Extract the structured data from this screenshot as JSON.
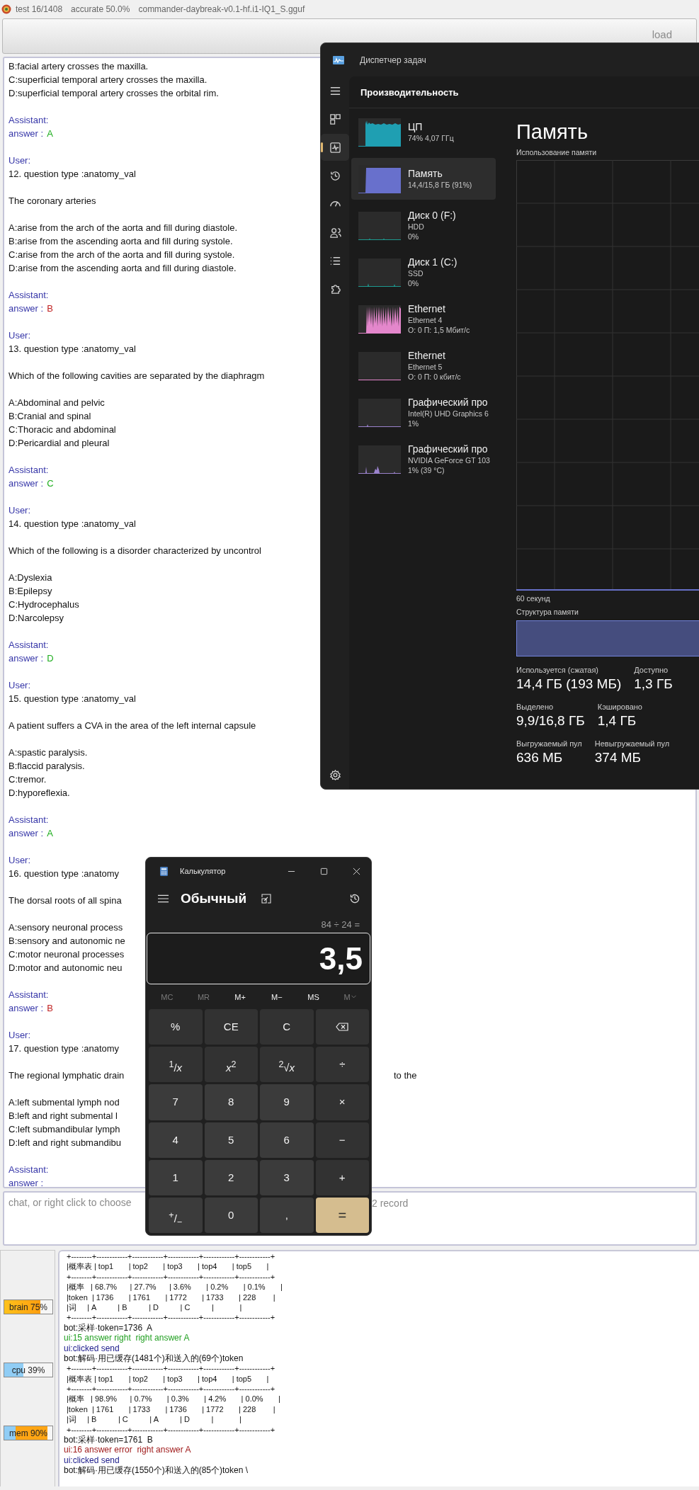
{
  "app": {
    "test": "test 16/1408",
    "accuracy": "accurate 50.0%",
    "model": "commander-daybreak-v0.1-hf.i1-IQ1_S.gguf",
    "load_button": "load"
  },
  "chat": {
    "lines": [
      {
        "kind": "option",
        "text": "B:facial artery crosses the maxilla."
      },
      {
        "kind": "option",
        "text": "C:superficial temporal artery crosses the maxilla."
      },
      {
        "kind": "option",
        "text": "D:superficial temporal artery crosses the orbital rim."
      },
      {
        "kind": "role",
        "text": "Assistant:"
      },
      {
        "kind": "answer",
        "text": "answer :",
        "choice": "A",
        "correct": true
      },
      {
        "kind": "role",
        "text": "User:"
      },
      {
        "kind": "header",
        "text": "12. question type :anatomy_val"
      },
      {
        "kind": "question",
        "text": "The coronary arteries"
      },
      {
        "kind": "option",
        "text": "A:arise from the arch of the aorta and fill during diastole."
      },
      {
        "kind": "option",
        "text": "B:arise from the ascending aorta and fill during systole."
      },
      {
        "kind": "option",
        "text": "C:arise from the arch of the aorta and fill during systole."
      },
      {
        "kind": "option",
        "text": "D:arise from the ascending aorta and fill during diastole."
      },
      {
        "kind": "role",
        "text": "Assistant:"
      },
      {
        "kind": "answer",
        "text": "answer :",
        "choice": "B",
        "correct": false
      },
      {
        "kind": "role",
        "text": "User:"
      },
      {
        "kind": "header",
        "text": "13. question type :anatomy_val"
      },
      {
        "kind": "question",
        "text": "Which of the following cavities are separated by the diaphragm"
      },
      {
        "kind": "option",
        "text": "A:Abdominal and pelvic"
      },
      {
        "kind": "option",
        "text": "B:Cranial and spinal"
      },
      {
        "kind": "option",
        "text": "C:Thoracic and abdominal"
      },
      {
        "kind": "option",
        "text": "D:Pericardial and pleural"
      },
      {
        "kind": "role",
        "text": "Assistant:"
      },
      {
        "kind": "answer",
        "text": "answer :",
        "choice": "C",
        "correct": true
      },
      {
        "kind": "role",
        "text": "User:"
      },
      {
        "kind": "header",
        "text": "14. question type :anatomy_val"
      },
      {
        "kind": "question",
        "text": "Which of the following is a disorder characterized by uncontrol"
      },
      {
        "kind": "option",
        "text": "A:Dyslexia"
      },
      {
        "kind": "option",
        "text": "B:Epilepsy"
      },
      {
        "kind": "option",
        "text": "C:Hydrocephalus"
      },
      {
        "kind": "option",
        "text": "D:Narcolepsy"
      },
      {
        "kind": "role",
        "text": "Assistant:"
      },
      {
        "kind": "answer",
        "text": "answer :",
        "choice": "D",
        "correct": true
      },
      {
        "kind": "role",
        "text": "User:"
      },
      {
        "kind": "header",
        "text": "15. question type :anatomy_val"
      },
      {
        "kind": "question",
        "text": "A patient suffers a CVA in the area of the left internal capsule"
      },
      {
        "kind": "option",
        "text": "A:spastic paralysis."
      },
      {
        "kind": "option",
        "text": "B:flaccid paralysis."
      },
      {
        "kind": "option",
        "text": "C:tremor."
      },
      {
        "kind": "option",
        "text": "D:hyporeflexia."
      },
      {
        "kind": "role",
        "text": "Assistant:"
      },
      {
        "kind": "answer",
        "text": "answer :",
        "choice": "A",
        "correct": true
      },
      {
        "kind": "role",
        "text": "User:"
      },
      {
        "kind": "header",
        "text": "16. question type :anatomy"
      },
      {
        "kind": "question",
        "text": "The dorsal roots of all spina"
      },
      {
        "kind": "option",
        "text": "A:sensory neuronal process"
      },
      {
        "kind": "option",
        "text": "B:sensory and autonomic ne"
      },
      {
        "kind": "option",
        "text": "C:motor neuronal processes"
      },
      {
        "kind": "option",
        "text": "D:motor and autonomic neu"
      },
      {
        "kind": "role",
        "text": "Assistant:"
      },
      {
        "kind": "answer",
        "text": "answer :",
        "choice": "B",
        "correct": false
      },
      {
        "kind": "role",
        "text": "User:"
      },
      {
        "kind": "header",
        "text": "17. question type :anatomy"
      },
      {
        "kind": "question",
        "text": "The regional lymphatic drain",
        "tail": "to the"
      },
      {
        "kind": "option",
        "text": "A:left submental lymph nod"
      },
      {
        "kind": "option",
        "text": "B:left and right submental l"
      },
      {
        "kind": "option",
        "text": "C:left submandibular lymph"
      },
      {
        "kind": "option",
        "text": "D:left and right submandibu"
      },
      {
        "kind": "role",
        "text": "Assistant:"
      },
      {
        "kind": "answer",
        "text": "answer :"
      }
    ]
  },
  "input": {
    "placeholder": "chat, or right click to choose",
    "placeholder_tail": "2 record"
  },
  "meters": [
    {
      "kind": "brain",
      "label": "brain 75%",
      "level": 0.75
    },
    {
      "kind": "cpu",
      "label": "cpu 39%",
      "level": 0.39
    },
    {
      "kind": "mem",
      "label": "mem 90%",
      "level": 0.9
    }
  ],
  "log": [
    {
      "kind": "table",
      "text": "+--------+------------+------------+------------+------------+------------+"
    },
    {
      "kind": "table",
      "text": "|概率表 | top1       | top2       | top3       | top4       | top5       |"
    },
    {
      "kind": "table",
      "text": "+--------+------------+------------+------------+------------+------------+"
    },
    {
      "kind": "table",
      "text": "|概率   | 68.7%      | 27.7%      | 3.6%       | 0.2%       | 0.1%       |"
    },
    {
      "kind": "table",
      "text": "|token  | 1736       | 1761       | 1772       | 1733       | 228        |"
    },
    {
      "kind": "table",
      "text": "|词     | A          | B          | D          | C          |            |"
    },
    {
      "kind": "table",
      "text": "+--------+------------+------------+------------+------------+------------+"
    },
    {
      "kind": "bot",
      "text": "bot:采样·token=1736  A"
    },
    {
      "kind": "ok",
      "text": "ui:15 answer right  right answer A"
    },
    {
      "kind": "send",
      "text": "ui:clicked send"
    },
    {
      "kind": "bot",
      "text": "bot:解码·用已缓存(1481个)和送入的(69个)token"
    },
    {
      "kind": "table",
      "text": "+--------+------------+------------+------------+------------+------------+"
    },
    {
      "kind": "table",
      "text": "|概率表 | top1       | top2       | top3       | top4       | top5       |"
    },
    {
      "kind": "table",
      "text": "+--------+------------+------------+------------+------------+------------+"
    },
    {
      "kind": "table",
      "text": "|概率   | 98.9%      | 0.7%       | 0.3%       | 4.2%       | 0.0%       |"
    },
    {
      "kind": "table",
      "text": "|token  | 1761       | 1733       | 1736       | 1772       | 228        |"
    },
    {
      "kind": "table",
      "text": "|词     | B          | C          | A          | D          |            |"
    },
    {
      "kind": "table",
      "text": "+--------+------------+------------+------------+------------+------------+"
    },
    {
      "kind": "bot",
      "text": "bot:采样·token=1761  B"
    },
    {
      "kind": "error",
      "text": "ui:16 answer error  right answer A"
    },
    {
      "kind": "send",
      "text": "ui:clicked send"
    },
    {
      "kind": "bot",
      "text": "bot:解码·用已缓存(1550个)和送入的(85个)token \\"
    }
  ],
  "task_manager": {
    "title": "Диспетчер задач",
    "nav": [
      {
        "kind": "menu",
        "selected": false
      },
      {
        "kind": "processes",
        "selected": false
      },
      {
        "kind": "performance",
        "selected": true
      },
      {
        "kind": "history",
        "selected": false
      },
      {
        "kind": "startup",
        "selected": false
      },
      {
        "kind": "users",
        "selected": false
      },
      {
        "kind": "details",
        "selected": false
      },
      {
        "kind": "services",
        "selected": false
      },
      {
        "kind": "settings",
        "selected": false
      }
    ],
    "section": "Производительность",
    "devices": [
      {
        "name": "ЦП",
        "details": [
          "74%  4,07 ГГц"
        ],
        "color": "#1f9fb2",
        "selected": false
      },
      {
        "name": "Память",
        "details": [
          "14,4/15,8 ГБ (91%)"
        ],
        "color": "#6870cc",
        "selected": true
      },
      {
        "name": "Диск 0 (F:)",
        "details": [
          "HDD",
          "0%"
        ],
        "color": "#1d9a90",
        "selected": false
      },
      {
        "name": "Диск 1 (C:)",
        "details": [
          "SSD",
          "0%"
        ],
        "color": "#1d9a90",
        "selected": false
      },
      {
        "name": "Ethernet",
        "details": [
          "Ethernet 4",
          "О: 0 П: 1,5 Мбит/с"
        ],
        "color": "#e487cc",
        "selected": false
      },
      {
        "name": "Ethernet",
        "details": [
          "Ethernet 5",
          "О: 0 П: 0 кбит/с"
        ],
        "color": "#e487cc",
        "selected": false
      },
      {
        "name": "Графический про",
        "details": [
          "Intel(R) UHD Graphics 6",
          "1%"
        ],
        "color": "#9a82cc",
        "selected": false
      },
      {
        "name": "Графический про",
        "details": [
          "NVIDIA GeForce GT 103",
          "1%  (39 °C)"
        ],
        "color": "#9a82cc",
        "selected": false
      }
    ],
    "detail": {
      "title": "Память",
      "graph_label": "Использование памяти",
      "time_label": "60 секунд",
      "composition_label": "Структура памяти",
      "stat_rows": [
        [
          {
            "label": "Используется (сжатая)",
            "value": "14,4 ГБ (193 МБ)"
          },
          {
            "label": "Доступно",
            "value": "1,3 ГБ"
          }
        ],
        [
          {
            "label": "Выделено",
            "value": "9,9/16,8 ГБ"
          },
          {
            "label": "Кэшировано",
            "value": "1,4 ГБ"
          }
        ],
        [
          {
            "label": "Выгружаемый пул",
            "value": "636 МБ"
          },
          {
            "label": "Невыгружаемый пул",
            "value": "374 МБ"
          }
        ]
      ]
    }
  },
  "calculator": {
    "title": "Калькулятор",
    "mode": "Обычный",
    "expression": "84 ÷ 24 =",
    "display": "3,5",
    "memory": [
      {
        "label": "MC",
        "disabled": true
      },
      {
        "label": "MR",
        "disabled": true
      },
      {
        "label": "M+",
        "disabled": false
      },
      {
        "label": "M−",
        "disabled": false
      },
      {
        "label": "MS",
        "disabled": false
      },
      {
        "label": "M",
        "disabled": true
      }
    ],
    "keys": [
      {
        "kind": "function",
        "label": "%"
      },
      {
        "kind": "function",
        "label": "CE"
      },
      {
        "kind": "function",
        "label": "C"
      },
      {
        "kind": "backspace"
      },
      {
        "kind": "function",
        "label": "$^{1}$/*x*"
      },
      {
        "kind": "function",
        "label": "*x*$^{2}$"
      },
      {
        "kind": "function",
        "label": "$^{2}$√*x*"
      },
      {
        "kind": "function",
        "label": "÷"
      },
      {
        "kind": "digit",
        "label": "7"
      },
      {
        "kind": "digit",
        "label": "8"
      },
      {
        "kind": "digit",
        "label": "9"
      },
      {
        "kind": "function",
        "label": "×"
      },
      {
        "kind": "digit",
        "label": "4"
      },
      {
        "kind": "digit",
        "label": "5"
      },
      {
        "kind": "digit",
        "label": "6"
      },
      {
        "kind": "function",
        "label": "−"
      },
      {
        "kind": "digit",
        "label": "1"
      },
      {
        "kind": "digit",
        "label": "2"
      },
      {
        "kind": "digit",
        "label": "3"
      },
      {
        "kind": "function",
        "label": "+"
      },
      {
        "kind": "digit",
        "label": "$^{+}$/$_{−}$"
      },
      {
        "kind": "digit",
        "label": "0"
      },
      {
        "kind": "digit",
        "label": ","
      },
      {
        "kind": "equals",
        "label": "="
      }
    ]
  }
}
